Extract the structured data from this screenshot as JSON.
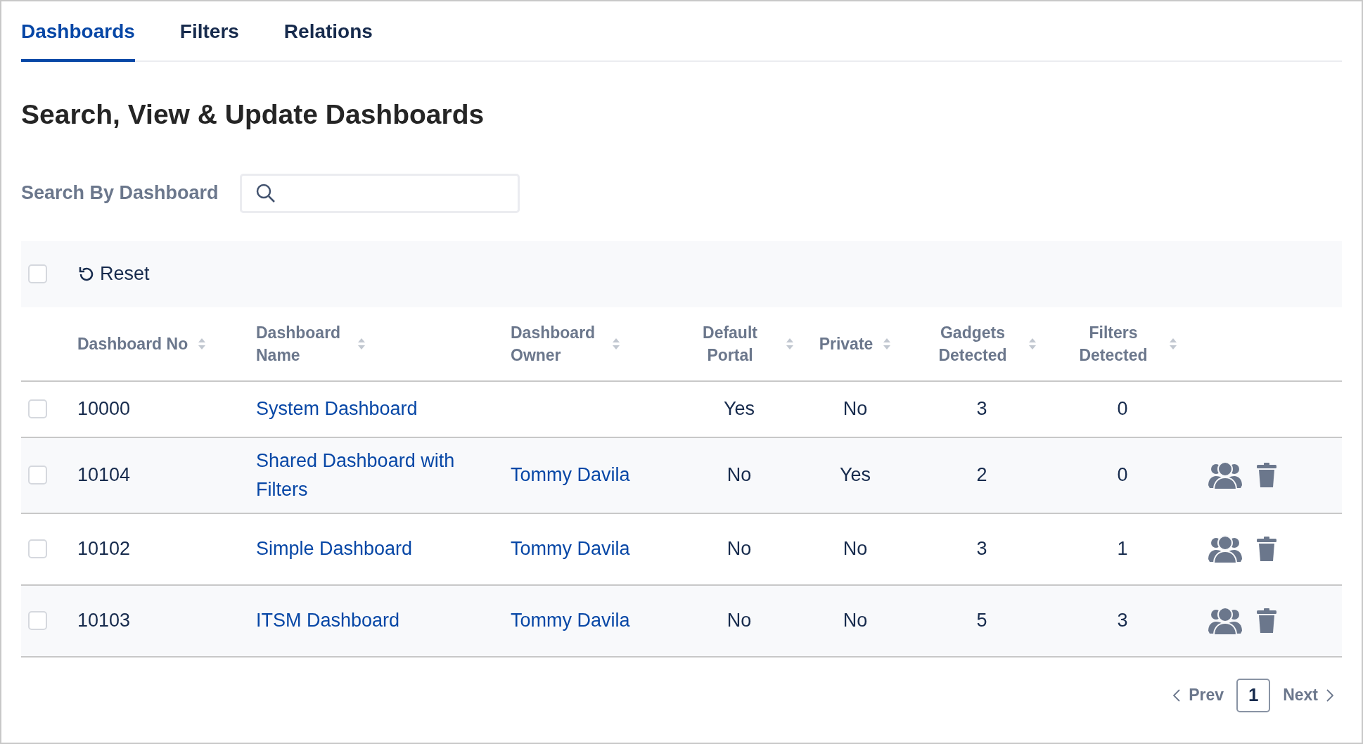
{
  "tabs": [
    {
      "label": "Dashboards",
      "selected": true
    },
    {
      "label": "Filters",
      "selected": false
    },
    {
      "label": "Relations",
      "selected": false
    }
  ],
  "heading": "Search, View & Update Dashboards",
  "search": {
    "label": "Search By Dashboard"
  },
  "toolbar": {
    "select_all_checked": false,
    "reset": "Reset"
  },
  "table": {
    "columns": [
      "Dashboard No",
      "Dashboard Name",
      "Dashboard Owner",
      "Default Portal",
      "Private",
      "Gadgets Detected",
      "Filters Detected"
    ],
    "rows": [
      {
        "checked": false,
        "no": "10000",
        "name": "System Dashboard",
        "owner": "",
        "default_portal": "Yes",
        "private": "No",
        "gadgets": "3",
        "filters": "0",
        "actions": false
      },
      {
        "checked": false,
        "no": "10104",
        "name": "Shared Dashboard with Filters",
        "owner": "Tommy Davila",
        "default_portal": "No",
        "private": "Yes",
        "gadgets": "2",
        "filters": "0",
        "actions": true
      },
      {
        "checked": false,
        "no": "10102",
        "name": "Simple Dashboard",
        "owner": "Tommy Davila",
        "default_portal": "No",
        "private": "No",
        "gadgets": "3",
        "filters": "1",
        "actions": true
      },
      {
        "checked": false,
        "no": "10103",
        "name": "ITSM Dashboard",
        "owner": "Tommy Davila",
        "default_portal": "No",
        "private": "No",
        "gadgets": "5",
        "filters": "3",
        "actions": true
      }
    ]
  },
  "pagination": {
    "prev": "Prev",
    "pages": [
      {
        "label": "1",
        "selected": true
      }
    ],
    "next": "Next"
  }
}
